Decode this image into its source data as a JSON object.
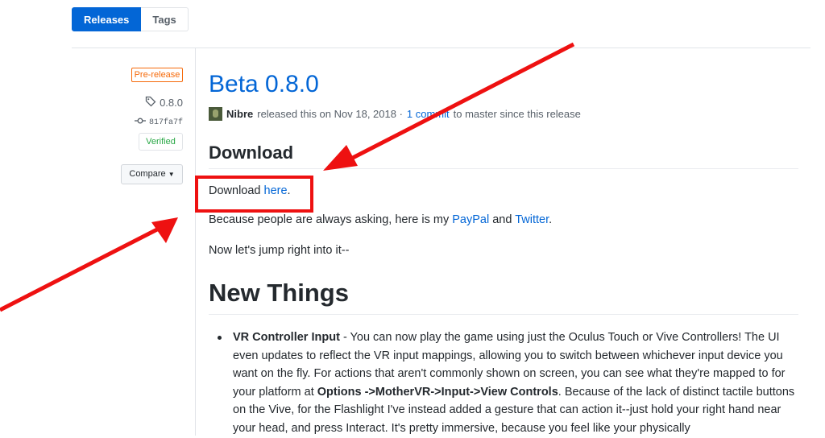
{
  "tabs": {
    "releases": "Releases",
    "tags": "Tags"
  },
  "sidebar": {
    "badge": "Pre-release",
    "tag": "0.8.0",
    "commit": "817fa7f",
    "verified": "Verified",
    "compare": "Compare"
  },
  "release": {
    "title": "Beta 0.8.0",
    "author": "Nibre",
    "released_text": "released this on Nov 18, 2018 ·",
    "commits_link": "1 commit",
    "commits_suffix": "to master since this release"
  },
  "content": {
    "download_heading": "Download",
    "download_prefix": "Download ",
    "download_link": "here",
    "download_suffix": ".",
    "paypal_prefix": "Because people are always asking, here is my ",
    "paypal_link": "PayPal",
    "and": " and ",
    "twitter_link": "Twitter",
    "twitter_suffix": ".",
    "jump_text": "Now let's jump right into it--",
    "new_things_heading": "New Things",
    "bullet_title": "VR Controller Input",
    "bullet_text_1": " - You can now play the game using just the Oculus Touch or Vive Controllers! The UI even updates to reflect the VR input mappings, allowing you to switch between whichever input device you want on the fly. For actions that aren't commonly shown on screen, you can see what they're mapped to for your platform at ",
    "bullet_bold_2": "Options ->MotherVR->Input->View Controls",
    "bullet_text_2": ". Because of the lack of distinct tactile buttons on the Vive, for the Flashlight I've instead added a gesture that can action it--just hold your right hand near your head, and press Interact. It's pretty immersive, because you feel like your physically"
  },
  "annotation_color": "#ee1111"
}
